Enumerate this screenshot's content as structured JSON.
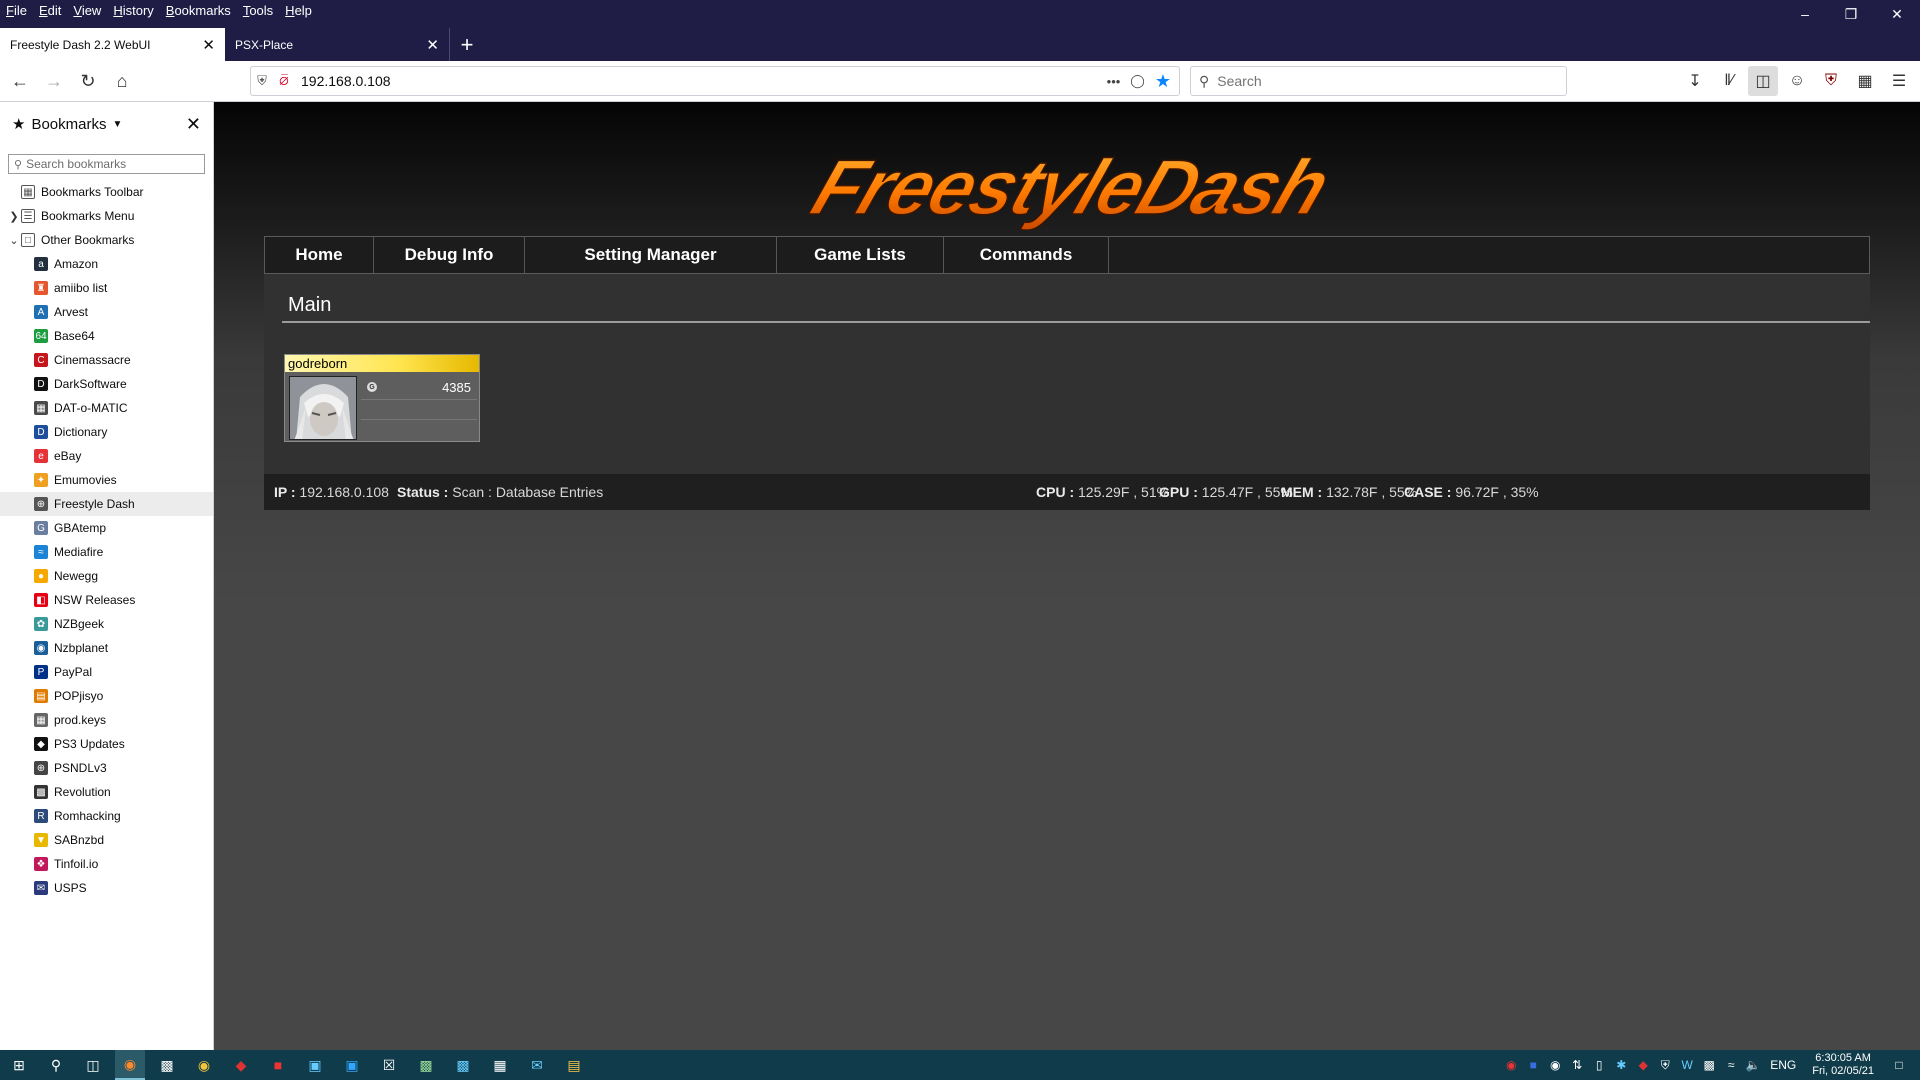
{
  "browser": {
    "menu": [
      "File",
      "Edit",
      "View",
      "History",
      "Bookmarks",
      "Tools",
      "Help"
    ],
    "tabs": [
      {
        "title": "Freestyle Dash 2.2 WebUI",
        "active": true
      },
      {
        "title": "PSX-Place",
        "active": false
      }
    ],
    "url": "192.168.0.108",
    "search_placeholder": "Search"
  },
  "sidebar": {
    "title": "Bookmarks",
    "search_placeholder": "Search bookmarks",
    "folders": [
      {
        "label": "Bookmarks Toolbar"
      },
      {
        "label": "Bookmarks Menu"
      },
      {
        "label": "Other Bookmarks"
      }
    ],
    "items": [
      {
        "label": "Amazon",
        "color": "#232f3e",
        "glyph": "a"
      },
      {
        "label": "amiibo list",
        "color": "#e4572e",
        "glyph": "♜"
      },
      {
        "label": "Arvest",
        "color": "#1f6fb5",
        "glyph": "A"
      },
      {
        "label": "Base64",
        "color": "#1e9d3f",
        "glyph": "64"
      },
      {
        "label": "Cinemassacre",
        "color": "#c4161c",
        "glyph": "C"
      },
      {
        "label": "DarkSoftware",
        "color": "#111111",
        "glyph": "D"
      },
      {
        "label": "DAT-o-MATIC",
        "color": "#4a4a4a",
        "glyph": "▦"
      },
      {
        "label": "Dictionary",
        "color": "#1d4f9c",
        "glyph": "D"
      },
      {
        "label": "eBay",
        "color": "#e53238",
        "glyph": "e"
      },
      {
        "label": "Emumovies",
        "color": "#f0a020",
        "glyph": "✦"
      },
      {
        "label": "Freestyle Dash",
        "color": "#555555",
        "glyph": "⊕"
      },
      {
        "label": "GBAtemp",
        "color": "#6a7fa0",
        "glyph": "G"
      },
      {
        "label": "Mediafire",
        "color": "#1b84d7",
        "glyph": "≈"
      },
      {
        "label": "Newegg",
        "color": "#f7a800",
        "glyph": "●"
      },
      {
        "label": "NSW Releases",
        "color": "#e60012",
        "glyph": "◧"
      },
      {
        "label": "NZBgeek",
        "color": "#3a9a9a",
        "glyph": "✿"
      },
      {
        "label": "Nzbplanet",
        "color": "#1a5e9a",
        "glyph": "◉"
      },
      {
        "label": "PayPal",
        "color": "#003087",
        "glyph": "P"
      },
      {
        "label": "POPjisyo",
        "color": "#e07b00",
        "glyph": "▤"
      },
      {
        "label": "prod.keys",
        "color": "#666666",
        "glyph": "▦"
      },
      {
        "label": "PS3 Updates",
        "color": "#111111",
        "glyph": "◆"
      },
      {
        "label": "PSNDLv3",
        "color": "#444444",
        "glyph": "⊕"
      },
      {
        "label": "Revolution",
        "color": "#333333",
        "glyph": "▩"
      },
      {
        "label": "Romhacking",
        "color": "#2c4a7a",
        "glyph": "R"
      },
      {
        "label": "SABnzbd",
        "color": "#e8b800",
        "glyph": "▼"
      },
      {
        "label": "Tinfoil.io",
        "color": "#c2185b",
        "glyph": "❖"
      },
      {
        "label": "USPS",
        "color": "#2a3a7a",
        "glyph": "✉"
      }
    ]
  },
  "page": {
    "logo_text": "FreestyleDash",
    "nav": [
      {
        "label": "Home"
      },
      {
        "label": "Debug Info"
      },
      {
        "label": "Setting Manager"
      },
      {
        "label": "Game Lists"
      },
      {
        "label": "Commands"
      }
    ],
    "section_title": "Main",
    "gamer": {
      "name": "godreborn",
      "gamerscore": "4385",
      "badge": "G"
    },
    "status": {
      "ip_label": "IP :",
      "ip": "192.168.0.108",
      "status_label": "Status :",
      "status": "Scan : Database Entries",
      "cpu_label": "CPU :",
      "cpu": "125.29F , 51%",
      "gpu_label": "GPU :",
      "gpu": "125.47F , 55%",
      "mem_label": "MEM :",
      "mem": "132.78F , 55%",
      "case_label": "CASE :",
      "case": "96.72F , 35%"
    }
  },
  "taskbar": {
    "lang": "ENG",
    "time": "6:30:05 AM",
    "date": "Fri, 02/05/21"
  }
}
